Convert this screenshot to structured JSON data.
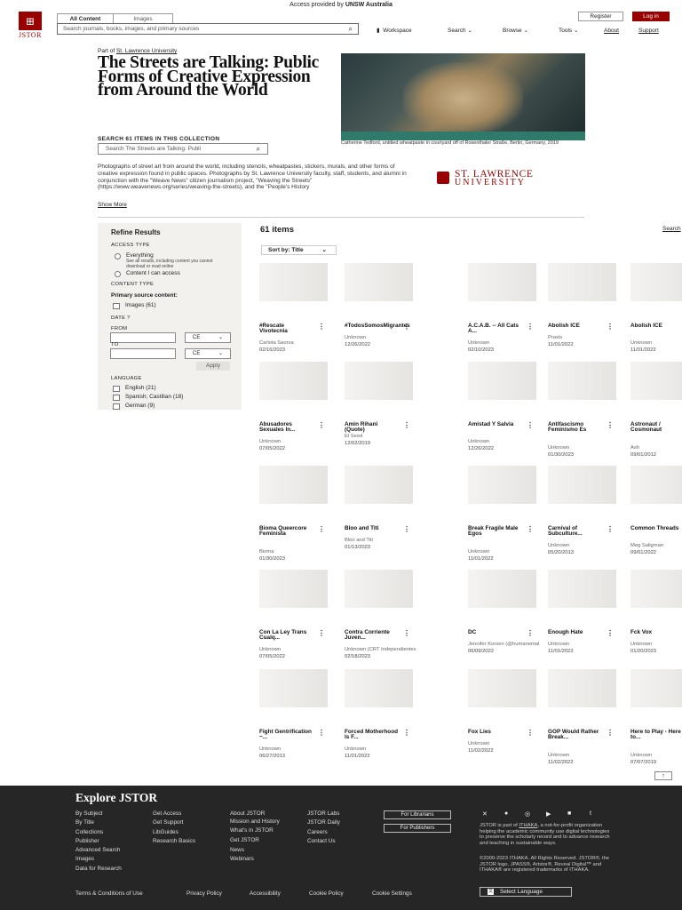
{
  "access_bar": {
    "prefix": "Access provided by",
    "institution": "UNSW Australia"
  },
  "header": {
    "logo_text": "JSTOR",
    "tabs": [
      "All Content",
      "Images"
    ],
    "search_placeholder": "Search journals, books, images, and primary sources",
    "register": "Register",
    "login": "Log in",
    "nav": [
      "Workspace",
      "Search",
      "Browse",
      "Tools",
      "About",
      "Support"
    ]
  },
  "collection": {
    "part_of_prefix": "Part of",
    "part_of": "St. Lawrence University",
    "title": "The Streets are Talking: Public Forms of Creative Expression from Around the World",
    "image_caption": "Catherine Tedford, untitled wheatpaste in courtyard off of Rosenthaler Straße, Berlin, Germany, 2019",
    "search_label": "SEARCH 61 ITEMS IN THIS COLLECTION",
    "search_placeholder": "Search The Streets are Talking: Publi",
    "description": "Photographs of street art from around the world, including stencils, wheatpastes, stickers, murals, and other forms of creative expression found in public spaces. Photographs by St. Lawrence University faculty, staff, students, and alumni in conjunction with the \"Weave News\" citizen journalism project, \"Weaving the Streets\" (https://www.weavenews.org/series/weaving-the-streets), and the \"People's History",
    "show_more": "Show More",
    "logo_line1": "ST. LAWRENCE",
    "logo_line2": "UNIVERSITY"
  },
  "sidebar": {
    "title": "Refine Results",
    "access_type": "ACCESS TYPE",
    "everything": "Everything",
    "everything_sub": "See all results, including content you cannot download or read online",
    "content_access": "Content I can access",
    "content_type": "CONTENT TYPE",
    "primary_source": "Primary source content:",
    "images": "Images (61)",
    "date": "DATE",
    "from": "FROM",
    "to": "TO",
    "era": "CE",
    "apply": "Apply",
    "language": "LANGUAGE",
    "languages": [
      "English (21)",
      "Spanish; Castilian (18)",
      "German (9)"
    ]
  },
  "results": {
    "count": "61 items",
    "search_link": "Search",
    "sort": "Sort by: Title"
  },
  "items": [
    {
      "title": "#Rescate Vivotecnia",
      "creator": "Carlota Saorsa",
      "date": "02/16/2023"
    },
    {
      "title": "#TodosSomosMigrantes",
      "creator": "Unknown",
      "date": "12/26/2022"
    },
    {
      "title": "A.C.A.B. -- All Cats A...",
      "creator": "Unknown",
      "date": "02/10/2023"
    },
    {
      "title": "Abolish ICE",
      "creator": "Praxis",
      "date": "11/01/2022"
    },
    {
      "title": "Abolish ICE",
      "creator": "Unknown",
      "date": "11/01/2022"
    },
    {
      "title": "Abusadores Sexuales In...",
      "creator": "Unknown",
      "date": "07/05/2022"
    },
    {
      "title": "Amin Rihani (Quote)",
      "creator": "El Seed",
      "date": "12/02/2019"
    },
    {
      "title": "Amistad Y Salvia",
      "creator": "Unknown",
      "date": "12/26/2022"
    },
    {
      "title": "Antifascismo Feminismo Es",
      "creator": "Unknown",
      "date": "01/30/2023"
    },
    {
      "title": "Astronaut / Cosmonaut",
      "creator": "Ash",
      "date": "09/01/2012"
    },
    {
      "title": "Bioma Queercore Feminista",
      "creator": "Bioma",
      "date": "01/30/2023"
    },
    {
      "title": "Bloo and Titi",
      "creator": "Bloo and Titi",
      "date": "01/13/2023"
    },
    {
      "title": "Break Fragile Male Egos",
      "creator": "Unknown",
      "date": "11/01/2022"
    },
    {
      "title": "Carnival of Subculture...",
      "creator": "Unknown",
      "date": "05/20/2013"
    },
    {
      "title": "Common Threads",
      "creator": "Meg Saligman",
      "date": "09/01/2022"
    },
    {
      "title": "Con La Ley Trans Cualq...",
      "creator": "Unknown",
      "date": "07/05/2022"
    },
    {
      "title": "Contra Corriente Juven...",
      "creator": "Unknown (CRT Independientes)",
      "date": "02/18/2023"
    },
    {
      "title": "DC",
      "creator": "Jennifer Korsen (@humanemakeart)",
      "date": "06/09/2022"
    },
    {
      "title": "Enough Hate",
      "creator": "Unknown",
      "date": "11/01/2022"
    },
    {
      "title": "Fck Vox",
      "creator": "Unknown",
      "date": "01/20/2023"
    },
    {
      "title": "Fight Gentrification ~...",
      "creator": "Unknown",
      "date": "06/27/2013"
    },
    {
      "title": "Forced Motherhood Is F...",
      "creator": "Unknown",
      "date": "11/01/2022"
    },
    {
      "title": "Fox Lies",
      "creator": "Unknown",
      "date": "11/02/2022"
    },
    {
      "title": "GOP Would Rather Break...",
      "creator": "Unknown",
      "date": "11/02/2022"
    },
    {
      "title": "Here to Play - Here to...",
      "creator": "Unknown",
      "date": "07/07/2019"
    }
  ],
  "back_to_top": "↑",
  "footer": {
    "title": "Explore JSTOR",
    "col1": [
      "By Subject",
      "By Title",
      "Collections",
      "Publisher",
      "Advanced Search",
      "Images",
      "Data for Research"
    ],
    "col2": [
      "Get Access",
      "Get Support",
      "LibGuides",
      "Research Basics"
    ],
    "col3": [
      "About JSTOR",
      "Mission and History",
      "What's in JSTOR",
      "Get JSTOR",
      "News",
      "Webinars"
    ],
    "col4": [
      "JSTOR Labs",
      "JSTOR Daily",
      "Careers",
      "Contact Us"
    ],
    "for_librarians": "For Librarians",
    "for_publishers": "For Publishers",
    "about_prefix": "JSTOR is part of",
    "about_link": "ITHAKA",
    "about_rest": ", a not-for-profit organization helping the academic community use digital technologies to preserve the scholarly record and to advance research and teaching in sustainable ways.",
    "copyright": "©2000-2023 ITHAKA. All Rights Reserved. JSTOR®, the JSTOR logo, JPASS®, Artstor®, Reveal Digital™ and ITHAKA® are registered trademarks of ITHAKA.",
    "legal": [
      "Terms & Conditions of Use",
      "Privacy Policy",
      "Accessibility",
      "Cookie Policy",
      "Cookie Settings"
    ],
    "language_button": "Select Language",
    "social_icons": [
      "twitter-icon",
      "facebook-icon",
      "instagram-icon",
      "youtube-icon",
      "linkedin-icon",
      "tumblr-icon"
    ]
  }
}
